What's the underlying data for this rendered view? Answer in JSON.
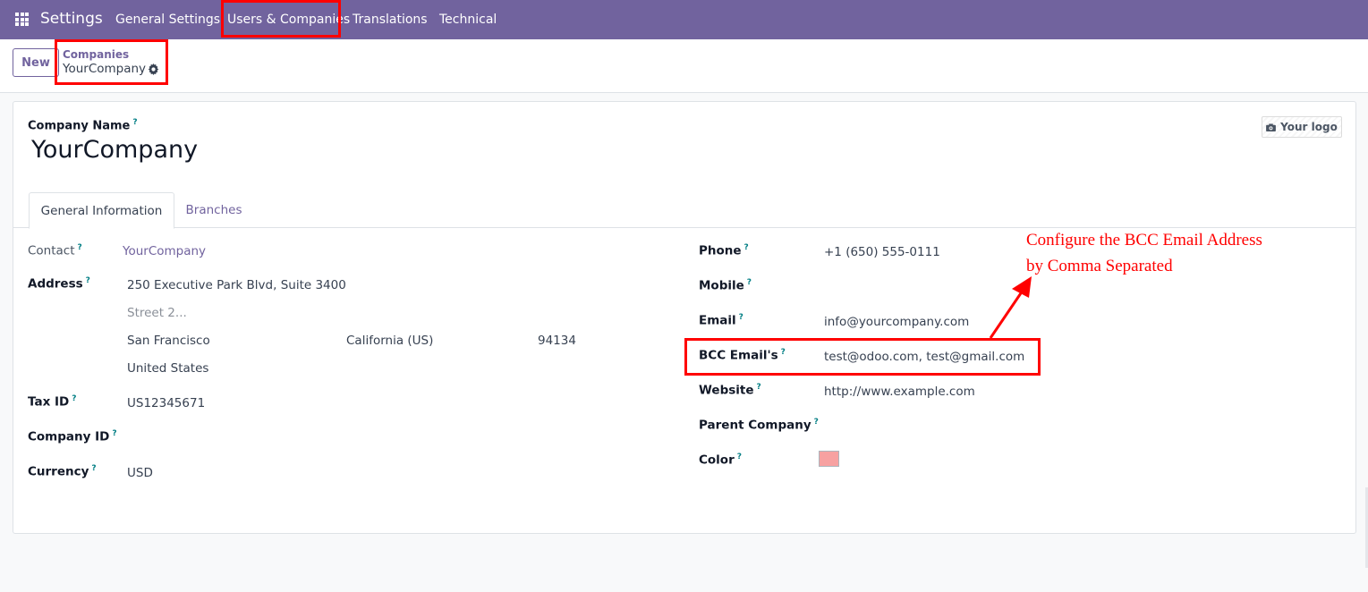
{
  "navbar": {
    "app_name": "Settings",
    "menu": [
      {
        "label": "General Settings"
      },
      {
        "label": "Users & Companies"
      },
      {
        "label": "Translations"
      },
      {
        "label": "Technical"
      }
    ]
  },
  "control_panel": {
    "new_label": "New",
    "breadcrumb_parent": "Companies",
    "breadcrumb_current": "YourCompany"
  },
  "form": {
    "company_name_label": "Company Name",
    "company_name": "YourCompany",
    "logo_label": "Your logo",
    "help_mark": "?",
    "tabs": [
      {
        "label": "General Information",
        "active": true
      },
      {
        "label": "Branches",
        "active": false
      }
    ],
    "left": {
      "contact_label": "Contact",
      "contact_value": "YourCompany",
      "address_label": "Address",
      "street": "250 Executive Park Blvd, Suite 3400",
      "street2_placeholder": "Street 2...",
      "city": "San Francisco",
      "state": "California (US)",
      "zip": "94134",
      "country": "United States",
      "tax_id_label": "Tax ID",
      "tax_id_value": "US12345671",
      "company_id_label": "Company ID",
      "company_id_value": "",
      "currency_label": "Currency",
      "currency_value": "USD"
    },
    "right": {
      "phone_label": "Phone",
      "phone_value": "+1 (650) 555-0111",
      "mobile_label": "Mobile",
      "mobile_value": "",
      "email_label": "Email",
      "email_value": "info@yourcompany.com",
      "bcc_label": "BCC Email's",
      "bcc_value": "test@odoo.com, test@gmail.com",
      "website_label": "Website",
      "website_value": "http://www.example.com",
      "parent_company_label": "Parent Company",
      "parent_company_value": "",
      "color_label": "Color",
      "color_value": "#f7a1a1"
    }
  },
  "annotation": {
    "line1": "Configure the BCC Email Address",
    "line2": "by Comma Separated",
    "color": "#ff0000"
  },
  "theme": {
    "brand": "#71639e",
    "help_color": "#017e84"
  }
}
